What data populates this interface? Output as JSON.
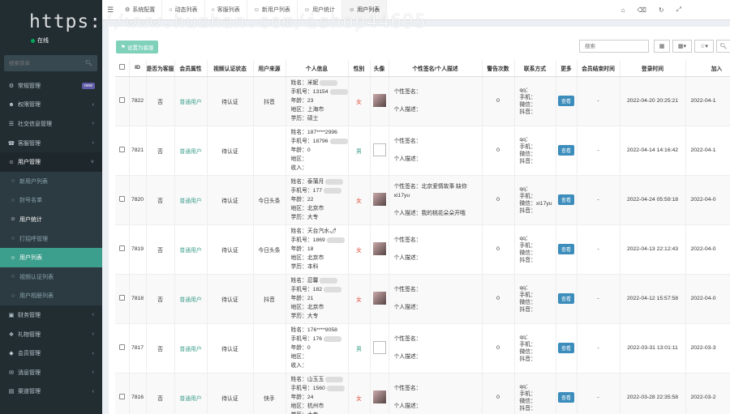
{
  "sidebar": {
    "user_status": "在线",
    "search_placeholder": "搜索菜单",
    "items": [
      {
        "label": "常规管理",
        "icon": "gear-icon",
        "badge": "new",
        "kind": "top"
      },
      {
        "label": "权限管理",
        "icon": "group-icon",
        "kind": "top"
      },
      {
        "label": "社交信息管理",
        "icon": "list-icon",
        "kind": "top"
      },
      {
        "label": "客服管理",
        "icon": "headset-icon",
        "kind": "top"
      },
      {
        "label": "用户管理",
        "icon": "users-icon",
        "kind": "open"
      },
      {
        "label": "新用户列表",
        "icon": "circle-icon",
        "kind": "sub"
      },
      {
        "label": "封号名单",
        "icon": "circle-icon",
        "kind": "sub"
      },
      {
        "label": "用户统计",
        "icon": "users-icon",
        "kind": "subwhite"
      },
      {
        "label": "打招呼管理",
        "icon": "circle-icon",
        "kind": "sub"
      },
      {
        "label": "用户列表",
        "icon": "users-icon",
        "kind": "active"
      },
      {
        "label": "视频认证列表",
        "icon": "circle-icon",
        "kind": "sub"
      },
      {
        "label": "用户相册列表",
        "icon": "circle-icon",
        "kind": "sub"
      },
      {
        "label": "财务管理",
        "icon": "money-icon",
        "kind": "top"
      },
      {
        "label": "礼物管理",
        "icon": "gift-icon",
        "kind": "top"
      },
      {
        "label": "会员管理",
        "icon": "diamond-icon",
        "kind": "top"
      },
      {
        "label": "消息管理",
        "icon": "message-icon",
        "kind": "top"
      },
      {
        "label": "渠道管理",
        "icon": "channel-icon",
        "kind": "top"
      }
    ]
  },
  "topbar": {
    "tabs": [
      {
        "label": "系统配置",
        "icon": "gear-icon"
      },
      {
        "label": "动态列表",
        "icon": "circle-icon"
      },
      {
        "label": "客服列表",
        "icon": "circle-icon"
      },
      {
        "label": "新用户列表",
        "icon": "users-icon"
      },
      {
        "label": "用户统计",
        "icon": "users-icon"
      },
      {
        "label": "用户列表",
        "icon": "user-icon",
        "active": true
      }
    ]
  },
  "toolbar": {
    "set_service_label": "设置为客服",
    "search_placeholder": "搜索"
  },
  "watermark": "https://www.huzhan.com/ishop44695",
  "table": {
    "headers": [
      "ID",
      "是否为客服",
      "会员属性",
      "视频认证状态",
      "用户来源",
      "个人信息",
      "性别",
      "头像",
      "个性签名/个人描述",
      "警告次数",
      "联系方式",
      "更多",
      "会员结束时间",
      "登录时间",
      "加入"
    ],
    "view_label": "查看",
    "rows": [
      {
        "id": "7822",
        "service": "否",
        "member": "普通用户",
        "video": "待认证",
        "source": "抖音",
        "info": [
          "姓名：米妮",
          "手机号：13154",
          "年龄：23",
          "地区：上海市",
          "学历：硕士"
        ],
        "gender": "女",
        "avatar": "photo",
        "sign": "个性签名：",
        "desc": "个人描述：",
        "warn": "0",
        "contact": [
          "qq：",
          "手机：",
          "微信：",
          "抖音："
        ],
        "member_end": "-",
        "login": "2022-04-20 20:25:21",
        "join": "2022-04-1"
      },
      {
        "id": "7821",
        "service": "否",
        "member": "普通用户",
        "video": "待认证",
        "source": "",
        "info": [
          "姓名：187****2996",
          "手机号：18796",
          "年龄：0",
          "地区：",
          "收入："
        ],
        "gender": "男",
        "avatar": "broken",
        "sign": "个性签名：",
        "desc": "个人描述：",
        "warn": "0",
        "contact": [
          "qq：",
          "手机：",
          "微信：",
          "抖音："
        ],
        "member_end": "-",
        "login": "2022-04-14 14:16:42",
        "join": "2022-04-1"
      },
      {
        "id": "7820",
        "service": "否",
        "member": "普通用户",
        "video": "待认证",
        "source": "今日头条",
        "info": [
          "姓名：泰蒲月",
          "手机号：177",
          "年龄：22",
          "地区：北京市",
          "学历：大专"
        ],
        "gender": "女",
        "avatar": "photo",
        "sign": "个性签名：北京爱情故事 缺你",
        "sign2": "xi17yu",
        "desc": "个人描述：我的桃花朵朵开哦",
        "warn": "0",
        "contact": [
          "qq：",
          "手机：",
          "微信：xi17yu",
          "抖音："
        ],
        "member_end": "-",
        "login": "2022-04-24 05:59:18",
        "join": "2022-04-0"
      },
      {
        "id": "7819",
        "service": "否",
        "member": "普通用户",
        "video": "待认证",
        "source": "今日头条",
        "info": [
          "姓名：天台汽水🌶",
          "手机号：1869",
          "年龄：18",
          "地区：北京市",
          "学历：本科"
        ],
        "gender": "女",
        "avatar": "photo",
        "sign": "个性签名：",
        "desc": "个人描述：",
        "warn": "0",
        "contact": [
          "qq：",
          "手机：",
          "微信：",
          "抖音："
        ],
        "member_end": "-",
        "login": "2022-04-13 22:12:43",
        "join": "2022-04-0"
      },
      {
        "id": "7818",
        "service": "否",
        "member": "普通用户",
        "video": "待认证",
        "source": "抖音",
        "info": [
          "姓名：忍馨",
          "手机号：182",
          "年龄：21",
          "地区：北京市",
          "学历：大专"
        ],
        "gender": "女",
        "avatar": "photo",
        "sign": "个性签名：",
        "desc": "个人描述：",
        "warn": "0",
        "contact": [
          "qq：",
          "手机：",
          "微信：",
          "抖音："
        ],
        "member_end": "-",
        "login": "2022-04-12 15:57:58",
        "join": "2022-04-0"
      },
      {
        "id": "7817",
        "service": "否",
        "member": "普通用户",
        "video": "待认证",
        "source": "",
        "info": [
          "姓名：176****9058",
          "手机号：176",
          "年龄：0",
          "地区：",
          "收入："
        ],
        "gender": "男",
        "avatar": "broken",
        "sign": "个性签名：",
        "desc": "个人描述：",
        "warn": "0",
        "contact": [
          "qq：",
          "手机：",
          "微信：",
          "抖音："
        ],
        "member_end": "-",
        "login": "2022-03-31 13:01:11",
        "join": "2022-03-3"
      },
      {
        "id": "7816",
        "service": "否",
        "member": "普通用户",
        "video": "待认证",
        "source": "快手",
        "info": [
          "姓名：山玉玉",
          "手机号：1560",
          "年龄：24",
          "地区：杭州市",
          "学历：大专"
        ],
        "gender": "女",
        "avatar": "photo",
        "sign": "个性签名：",
        "desc": "个人描述：",
        "warn": "0",
        "contact": [
          "qq：",
          "手机：",
          "微信：",
          "抖音："
        ],
        "member_end": "-",
        "login": "2022-03-28 22:35:58",
        "join": "2022-03-2"
      }
    ]
  }
}
